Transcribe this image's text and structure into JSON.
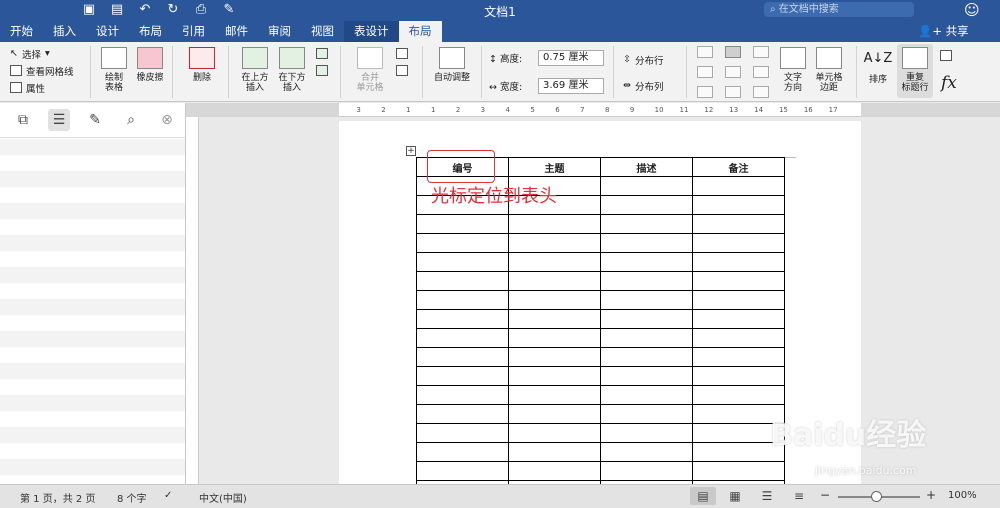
{
  "window": {
    "title": "文档1"
  },
  "search": {
    "placeholder": "在文档中搜索"
  },
  "tabs": [
    "开始",
    "插入",
    "设计",
    "布局",
    "引用",
    "邮件",
    "审阅",
    "视图",
    "表设计",
    "布局"
  ],
  "share_label": "共享",
  "ribbon": {
    "select_label": "选择",
    "view_gridlines_label": "查看网格线",
    "properties_label": "属性",
    "draw_table_label": "绘制\n表格",
    "eraser_label": "橡皮擦",
    "delete_label": "删除",
    "insert_above_label": "在上方\n插入",
    "insert_below_label": "在下方\n插入",
    "merge_cells_label": "合并\n单元格",
    "autofit_label": "自动调整",
    "height_label": "高度:",
    "height_value": "0.75 厘米",
    "width_label": "宽度:",
    "width_value": "3.69 厘米",
    "distribute_rows_label": "分布行",
    "distribute_cols_label": "分布列",
    "text_direction_label": "文字\n方向",
    "cell_margins_label": "单元格\n边距",
    "sort_label": "排序",
    "repeat_header_label": "重复\n标题行",
    "formula_label": "fx"
  },
  "ruler_ticks": [
    "3",
    "2",
    "1",
    "1",
    "2",
    "3",
    "4",
    "5",
    "6",
    "7",
    "8",
    "9",
    "10",
    "11",
    "12",
    "13",
    "14",
    "15",
    "16",
    "17"
  ],
  "table": {
    "headers": [
      "编号",
      "主题",
      "描述",
      "备注"
    ],
    "empty_rows": 17
  },
  "annotation": "光标定位到表头",
  "status": {
    "page": "第 1 页，共 2 页",
    "words": "8 个字",
    "language": "中文(中国)",
    "zoom": "100%",
    "zoom_level": 1.0
  },
  "watermark": {
    "text": "Baidu经验",
    "url": "jingyan.baidu.com"
  },
  "colors": {
    "accent": "#2b579a",
    "highlight": "#e0303b"
  }
}
